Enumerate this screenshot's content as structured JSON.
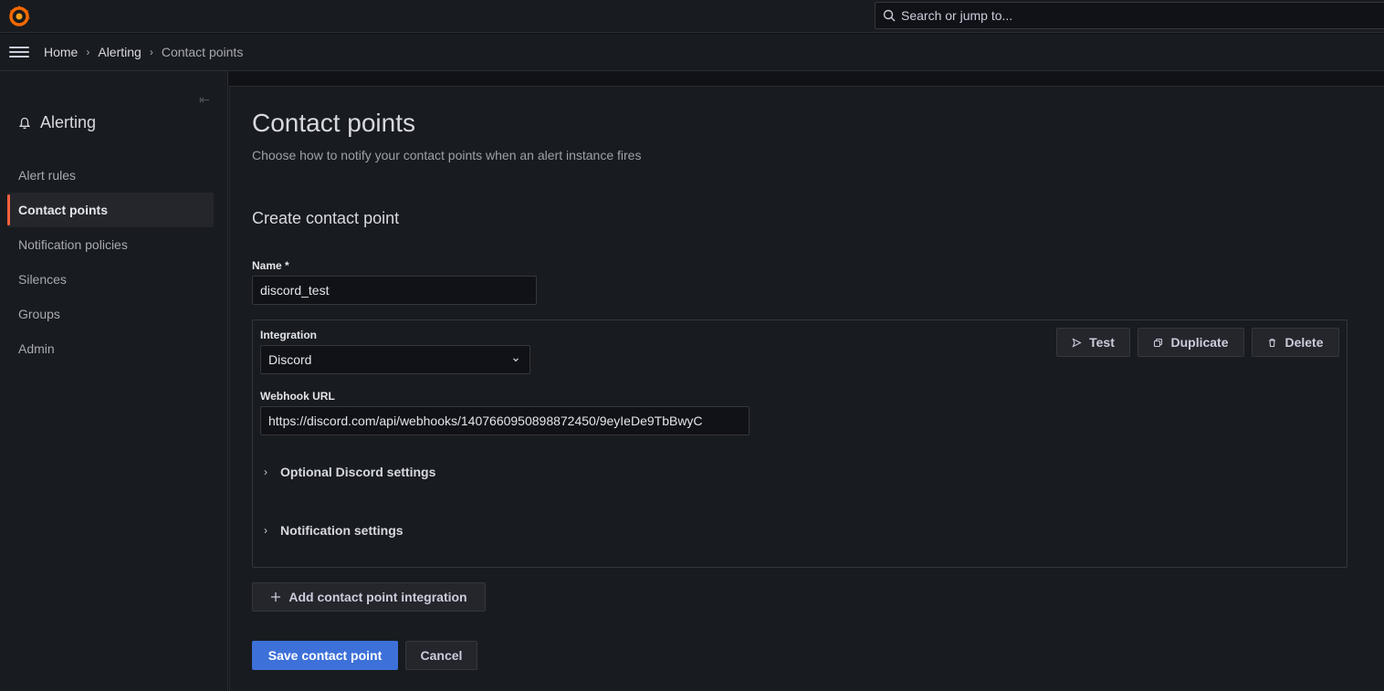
{
  "topbar": {
    "search_placeholder": "Search or jump to..."
  },
  "breadcrumb": {
    "items": [
      "Home",
      "Alerting",
      "Contact points"
    ]
  },
  "sidebar": {
    "title": "Alerting",
    "items": [
      {
        "label": "Alert rules",
        "active": false
      },
      {
        "label": "Contact points",
        "active": true
      },
      {
        "label": "Notification policies",
        "active": false
      },
      {
        "label": "Silences",
        "active": false
      },
      {
        "label": "Groups",
        "active": false
      },
      {
        "label": "Admin",
        "active": false
      }
    ]
  },
  "page": {
    "title": "Contact points",
    "subtitle": "Choose how to notify your contact points when an alert instance fires",
    "section_title": "Create contact point"
  },
  "form": {
    "name_label": "Name *",
    "name_value": "discord_test",
    "integration_label": "Integration",
    "integration_value": "Discord",
    "webhook_label": "Webhook URL",
    "webhook_value": "https://discord.com/api/webhooks/1407660950898872450/9eyIeDe9TbBwyC",
    "optional_settings": "Optional Discord settings",
    "notification_settings": "Notification settings"
  },
  "buttons": {
    "test": "Test",
    "duplicate": "Duplicate",
    "delete": "Delete",
    "add_integration": "Add contact point integration",
    "save": "Save contact point",
    "cancel": "Cancel"
  },
  "colors": {
    "background": "#111217",
    "panel": "#181b1f",
    "primary": "#3d71d9",
    "active_indicator": "#f55f3e",
    "logo": "#f46800"
  }
}
